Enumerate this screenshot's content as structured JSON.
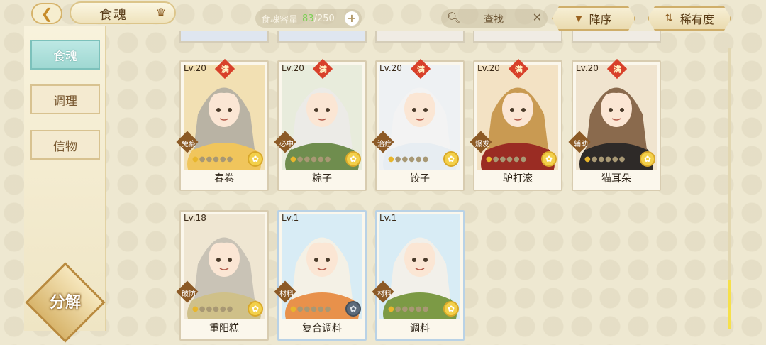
{
  "header": {
    "title": "食魂",
    "capacity_label": "食魂容量",
    "capacity_current": "83",
    "capacity_max": "/250",
    "search_placeholder": "查找",
    "sort_label": "降序",
    "rarity_label": "稀有度"
  },
  "sidebar": {
    "tabs": [
      {
        "label": "食魂",
        "active": true
      },
      {
        "label": "调理",
        "active": false
      },
      {
        "label": "信物",
        "active": false
      }
    ],
    "decompose_label": "分解"
  },
  "cards": [
    {
      "level": "Lv.20",
      "maxed": "满",
      "role": "免疫",
      "name": "春卷",
      "stars": 6,
      "lit": 1,
      "bg": "#f2e0b3",
      "hair": "#b9b3a4",
      "robe": "#f0c55c",
      "flower_dark": false
    },
    {
      "level": "Lv.20",
      "maxed": "满",
      "role": "必中",
      "name": "粽子",
      "stars": 6,
      "lit": 1,
      "bg": "#e8ecdc",
      "hair": "#ecebe7",
      "robe": "#6f8d4e",
      "flower_dark": false
    },
    {
      "level": "Lv.20",
      "maxed": "满",
      "role": "治疗",
      "name": "饺子",
      "stars": 6,
      "lit": 1,
      "bg": "#eef1f3",
      "hair": "#f3f3f3",
      "robe": "#e7edf2",
      "flower_dark": false
    },
    {
      "level": "Lv.20",
      "maxed": "满",
      "role": "爆发",
      "name": "驴打滚",
      "stars": 6,
      "lit": 1,
      "bg": "#f3e2c4",
      "hair": "#c99a52",
      "robe": "#9a2c23",
      "flower_dark": false
    },
    {
      "level": "Lv.20",
      "maxed": "满",
      "role": "辅助",
      "name": "猫耳朵",
      "stars": 6,
      "lit": 1,
      "bg": "#f0e4cf",
      "hair": "#8a6a4d",
      "robe": "#2e2a28",
      "flower_dark": false
    },
    {
      "level": "Lv.18",
      "maxed": "",
      "role": "破防",
      "name": "重阳糕",
      "stars": 6,
      "lit": 1,
      "bg": "#efe6d2",
      "hair": "#c9c3b6",
      "robe": "#cfc089",
      "flower_dark": false
    },
    {
      "level": "Lv.1",
      "maxed": "",
      "role": "材料",
      "name": "复合调料",
      "stars": 6,
      "lit": 1,
      "bg": "#d8ecf5",
      "hair": "#f4f1e6",
      "robe": "#e8914b",
      "flower_dark": true
    },
    {
      "level": "Lv.1",
      "maxed": "",
      "role": "材料",
      "name": "调料",
      "stars": 6,
      "lit": 1,
      "bg": "#d8ecf5",
      "hair": "#f2f0ea",
      "robe": "#7c9a45",
      "flower_dark": false
    }
  ]
}
